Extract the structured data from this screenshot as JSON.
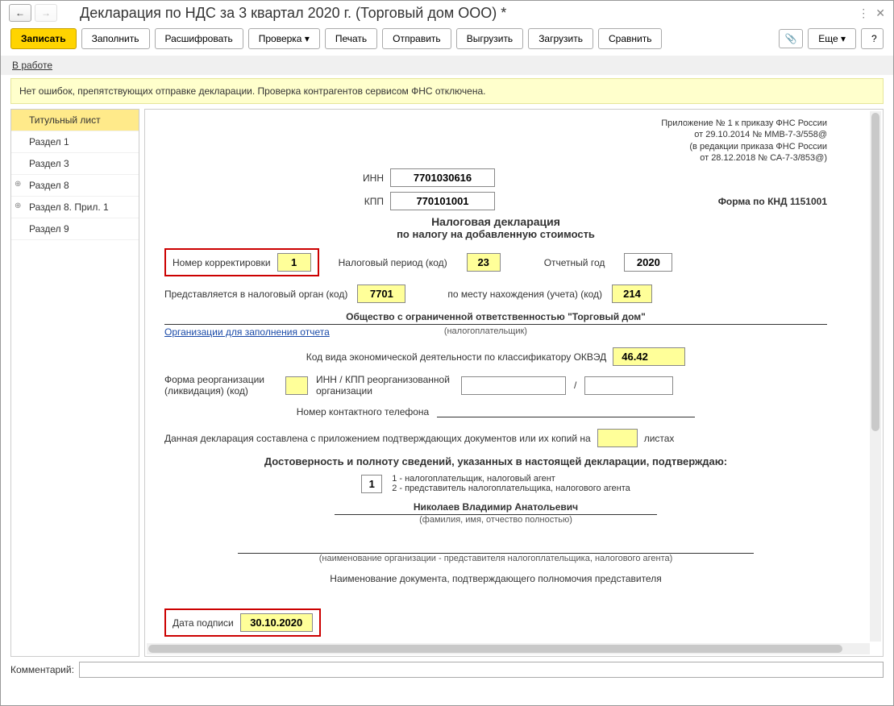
{
  "header": {
    "title": "Декларация по НДС за 3 квартал 2020 г. (Торговый дом ООО) *"
  },
  "toolbar": {
    "write": "Записать",
    "fill": "Заполнить",
    "decode": "Расшифровать",
    "check": "Проверка",
    "print": "Печать",
    "send": "Отправить",
    "unload": "Выгрузить",
    "load": "Загрузить",
    "compare": "Сравнить",
    "more": "Еще",
    "help": "?"
  },
  "status": {
    "label": "В работе"
  },
  "message": {
    "text": "Нет ошибок, препятствующих отправке декларации. Проверка контрагентов сервисом ФНС отключена."
  },
  "sidebar": {
    "items": [
      {
        "label": "Титульный лист",
        "active": true,
        "expand": false
      },
      {
        "label": "Раздел 1",
        "active": false,
        "expand": false
      },
      {
        "label": "Раздел 3",
        "active": false,
        "expand": false
      },
      {
        "label": "Раздел 8",
        "active": false,
        "expand": true
      },
      {
        "label": "Раздел 8. Прил. 1",
        "active": false,
        "expand": true
      },
      {
        "label": "Раздел 9",
        "active": false,
        "expand": false
      }
    ]
  },
  "form": {
    "annex": {
      "l1": "Приложение № 1 к приказу ФНС России",
      "l2": "от 29.10.2014 № ММВ-7-3/558@",
      "l3": "(в редакции приказа ФНС России",
      "l4": "от 28.12.2018 № СА-7-3/853@)"
    },
    "inn_label": "ИНН",
    "inn": "7701030616",
    "kpp_label": "КПП",
    "kpp": "770101001",
    "knd_label": "Форма по КНД 1151001",
    "h1": "Налоговая декларация",
    "h2": "по налогу на добавленную стоимость",
    "corr_label": "Номер корректировки",
    "corr": "1",
    "period_label": "Налоговый период (код)",
    "period": "23",
    "year_label": "Отчетный год",
    "year": "2020",
    "submit_label": "Представляется в налоговый орган (код)",
    "submit": "7701",
    "place_label": "по месту нахождения (учета) (код)",
    "place": "214",
    "company": "Общество с ограниченной ответственностью \"Торговый дом\"",
    "fill_link": "Организации для заполнения отчета",
    "taxpayer_note": "(налогоплательщик)",
    "okved_label": "Код вида экономической деятельности по классификатору ОКВЭД",
    "okved": "46.42",
    "reorg_label": "Форма реорганизации (ликвидация) (код)",
    "reorg_inn_label": "ИНН / КПП реорганизованной организации",
    "slash": "/",
    "phone_label": "Номер контактного телефона",
    "docs_label_pre": "Данная декларация составлена с приложением подтверждающих документов или их копий на",
    "docs_label_post": "листах",
    "confirm_header": "Достоверность и полноту сведений, указанных в настоящей декларации, подтверждаю:",
    "confirm_val": "1",
    "confirm_opt1": "1 - налогоплательщик, налоговый агент",
    "confirm_opt2": "2 - представитель налогоплательщика, налогового агента",
    "fio": "Николаев Владимир Анатольевич",
    "fio_note": "(фамилия, имя, отчество полностью)",
    "rep_note": "(наименование организации - представителя налогоплательщика, налогового агента)",
    "doc_name_label": "Наименование документа, подтверждающего полномочия представителя",
    "sign_date_label": "Дата подписи",
    "sign_date": "30.10.2020"
  },
  "comment": {
    "label": "Комментарий:",
    "value": ""
  }
}
